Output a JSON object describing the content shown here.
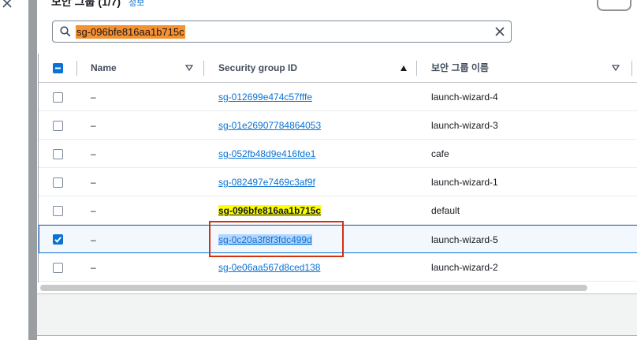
{
  "panel": {
    "title": "보안 그룹",
    "count": "(1/7)",
    "info_link": "정보"
  },
  "search": {
    "value": "sg-096bfe816aa1b715c"
  },
  "table": {
    "headers": {
      "name": "Name",
      "security_group_id": "Security group ID",
      "security_group_name": "보안 그룹 이름"
    },
    "rows": [
      {
        "name": "–",
        "id": "sg-012699e474c57fffe",
        "group_name": "launch-wizard-4",
        "checked": false
      },
      {
        "name": "–",
        "id": "sg-01e26907784864053",
        "group_name": "launch-wizard-3",
        "checked": false
      },
      {
        "name": "–",
        "id": "sg-052fb48d9e416fde1",
        "group_name": "cafe",
        "checked": false
      },
      {
        "name": "–",
        "id": "sg-082497e7469c3af9f",
        "group_name": "launch-wizard-1",
        "checked": false
      },
      {
        "name": "–",
        "id": "sg-096bfe816aa1b715c",
        "group_name": "default",
        "checked": false
      },
      {
        "name": "–",
        "id": "sg-0c20a3f8f3fdc499d",
        "group_name": "launch-wizard-5",
        "checked": true
      },
      {
        "name": "–",
        "id": "sg-0e06aa567d8ced138",
        "group_name": "launch-wizard-2",
        "checked": false
      }
    ]
  },
  "colors": {
    "accent": "#0972d3",
    "search_highlight": "#f7902f",
    "row_highlight": "#ffff00",
    "annotation_box": "#d13212"
  }
}
